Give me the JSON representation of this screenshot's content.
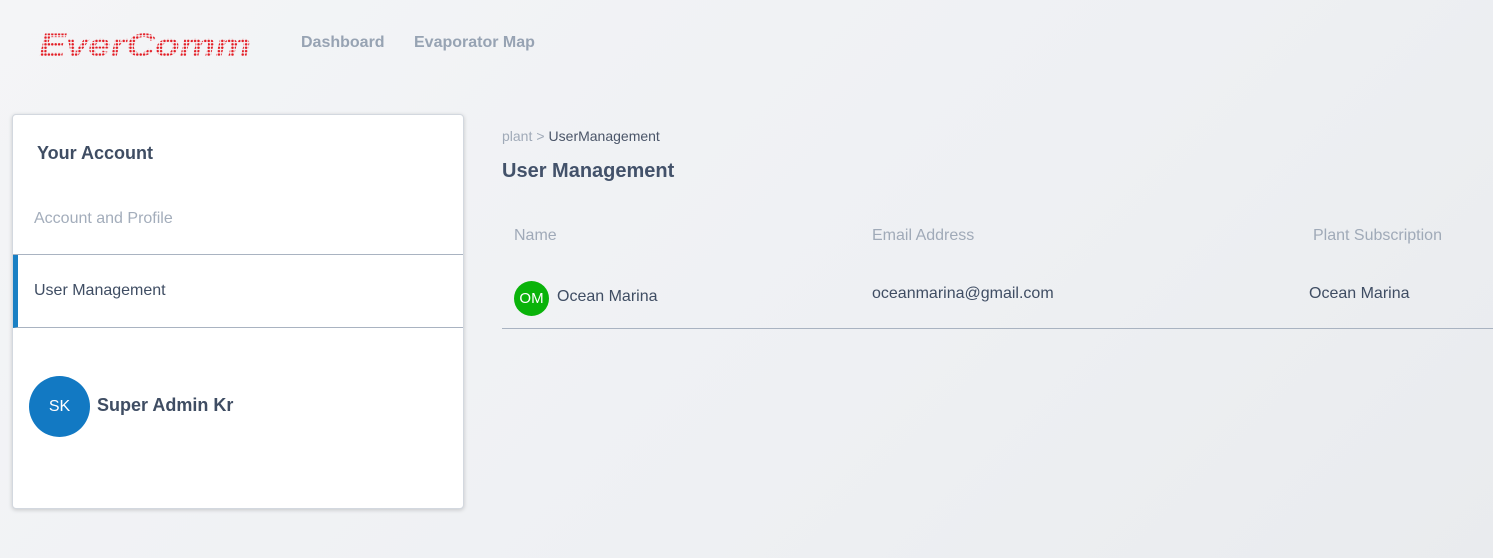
{
  "brand": {
    "logo_text": "EverComm",
    "logo_color": "#e31b23",
    "accent": "#1a80c4"
  },
  "nav": {
    "dashboard": "Dashboard",
    "evaporator_map": "Evaporator Map"
  },
  "sidebar": {
    "title": "Your Account",
    "items": [
      {
        "label": "Account and Profile",
        "active": false
      },
      {
        "label": "User Management",
        "active": true
      }
    ],
    "user": {
      "initials": "SK",
      "name": "Super Admin Kr",
      "avatar_color": "#1279c3"
    }
  },
  "breadcrumb": {
    "root": "plant",
    "separator": ">",
    "current": "UserManagement"
  },
  "page_title": "User Management",
  "table": {
    "headers": [
      "Name",
      "Email Address",
      "Plant Subscription"
    ],
    "rows": [
      {
        "initials": "OM",
        "name": "Ocean Marina",
        "email": "oceanmarina@gmail.com",
        "plant": "Ocean Marina",
        "avatar_color": "#0ab30a"
      }
    ]
  }
}
